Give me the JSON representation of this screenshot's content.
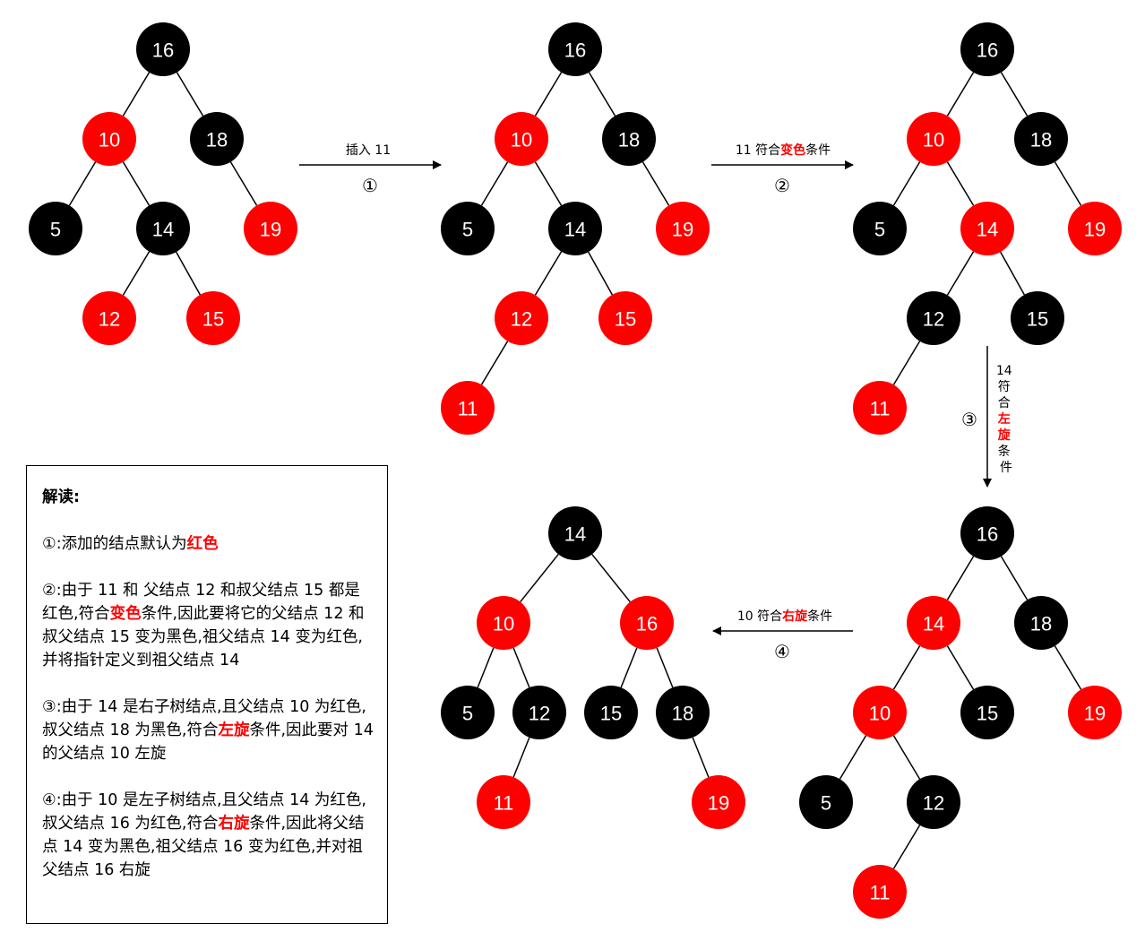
{
  "colors": {
    "red": "#ff0000",
    "black": "#000000"
  },
  "trees": [
    {
      "nodes": [
        {
          "id": "n16",
          "label": "16",
          "color": "black"
        },
        {
          "id": "n10",
          "label": "10",
          "color": "red"
        },
        {
          "id": "n18",
          "label": "18",
          "color": "black"
        },
        {
          "id": "n5",
          "label": "5",
          "color": "black"
        },
        {
          "id": "n14",
          "label": "14",
          "color": "black"
        },
        {
          "id": "n19",
          "label": "19",
          "color": "red"
        },
        {
          "id": "n12",
          "label": "12",
          "color": "red"
        },
        {
          "id": "n15",
          "label": "15",
          "color": "red"
        }
      ],
      "edges": [
        [
          "n16",
          "n10"
        ],
        [
          "n16",
          "n18"
        ],
        [
          "n10",
          "n5"
        ],
        [
          "n10",
          "n14"
        ],
        [
          "n18",
          "n19"
        ],
        [
          "n14",
          "n12"
        ],
        [
          "n14",
          "n15"
        ]
      ]
    },
    {
      "nodes": [
        {
          "id": "n16",
          "label": "16",
          "color": "black"
        },
        {
          "id": "n10",
          "label": "10",
          "color": "red"
        },
        {
          "id": "n18",
          "label": "18",
          "color": "black"
        },
        {
          "id": "n5",
          "label": "5",
          "color": "black"
        },
        {
          "id": "n14",
          "label": "14",
          "color": "black"
        },
        {
          "id": "n19",
          "label": "19",
          "color": "red"
        },
        {
          "id": "n12",
          "label": "12",
          "color": "red"
        },
        {
          "id": "n15",
          "label": "15",
          "color": "red"
        },
        {
          "id": "n11",
          "label": "11",
          "color": "red"
        }
      ],
      "edges": [
        [
          "n16",
          "n10"
        ],
        [
          "n16",
          "n18"
        ],
        [
          "n10",
          "n5"
        ],
        [
          "n10",
          "n14"
        ],
        [
          "n18",
          "n19"
        ],
        [
          "n14",
          "n12"
        ],
        [
          "n14",
          "n15"
        ],
        [
          "n12",
          "n11"
        ]
      ]
    },
    {
      "nodes": [
        {
          "id": "n16",
          "label": "16",
          "color": "black"
        },
        {
          "id": "n10",
          "label": "10",
          "color": "red"
        },
        {
          "id": "n18",
          "label": "18",
          "color": "black"
        },
        {
          "id": "n5",
          "label": "5",
          "color": "black"
        },
        {
          "id": "n14",
          "label": "14",
          "color": "red"
        },
        {
          "id": "n19",
          "label": "19",
          "color": "red"
        },
        {
          "id": "n12",
          "label": "12",
          "color": "black"
        },
        {
          "id": "n15",
          "label": "15",
          "color": "black"
        },
        {
          "id": "n11",
          "label": "11",
          "color": "red"
        }
      ],
      "edges": [
        [
          "n16",
          "n10"
        ],
        [
          "n16",
          "n18"
        ],
        [
          "n10",
          "n5"
        ],
        [
          "n10",
          "n14"
        ],
        [
          "n18",
          "n19"
        ],
        [
          "n14",
          "n12"
        ],
        [
          "n14",
          "n15"
        ],
        [
          "n12",
          "n11"
        ]
      ]
    },
    {
      "nodes": [
        {
          "id": "n16",
          "label": "16",
          "color": "black"
        },
        {
          "id": "n14",
          "label": "14",
          "color": "red"
        },
        {
          "id": "n18",
          "label": "18",
          "color": "black"
        },
        {
          "id": "n10",
          "label": "10",
          "color": "red"
        },
        {
          "id": "n15",
          "label": "15",
          "color": "black"
        },
        {
          "id": "n19",
          "label": "19",
          "color": "red"
        },
        {
          "id": "n5",
          "label": "5",
          "color": "black"
        },
        {
          "id": "n12",
          "label": "12",
          "color": "black"
        },
        {
          "id": "n11",
          "label": "11",
          "color": "red"
        }
      ],
      "edges": [
        [
          "n16",
          "n14"
        ],
        [
          "n16",
          "n18"
        ],
        [
          "n14",
          "n10"
        ],
        [
          "n14",
          "n15"
        ],
        [
          "n18",
          "n19"
        ],
        [
          "n10",
          "n5"
        ],
        [
          "n10",
          "n12"
        ],
        [
          "n12",
          "n11"
        ]
      ]
    },
    {
      "nodes": [
        {
          "id": "n14",
          "label": "14",
          "color": "black"
        },
        {
          "id": "n10",
          "label": "10",
          "color": "red"
        },
        {
          "id": "n16",
          "label": "16",
          "color": "red"
        },
        {
          "id": "n5",
          "label": "5",
          "color": "black"
        },
        {
          "id": "n12",
          "label": "12",
          "color": "black"
        },
        {
          "id": "n15",
          "label": "15",
          "color": "black"
        },
        {
          "id": "n18",
          "label": "18",
          "color": "black"
        },
        {
          "id": "n11",
          "label": "11",
          "color": "red"
        },
        {
          "id": "n19",
          "label": "19",
          "color": "red"
        }
      ],
      "edges": [
        [
          "n14",
          "n10"
        ],
        [
          "n14",
          "n16"
        ],
        [
          "n10",
          "n5"
        ],
        [
          "n10",
          "n12"
        ],
        [
          "n16",
          "n15"
        ],
        [
          "n16",
          "n18"
        ],
        [
          "n12",
          "n11"
        ],
        [
          "n18",
          "n19"
        ]
      ]
    }
  ],
  "steps": [
    {
      "num": "①",
      "label_parts": [
        "插入 11"
      ]
    },
    {
      "num": "②",
      "label_parts": [
        "11 符合",
        "变色",
        "条件"
      ]
    },
    {
      "num": "③",
      "label_parts": [
        "14",
        "符",
        "合",
        "左",
        "旋",
        "条",
        "件"
      ]
    },
    {
      "num": "④",
      "label_parts": [
        "10 符合",
        "右旋",
        "条件"
      ]
    }
  ],
  "note": {
    "title": "解读:",
    "p1": {
      "a": "①:添加的结点默认为",
      "em": "红色"
    },
    "p2": {
      "a": "②:由于 11 和 父结点 12 和叔父结点 15 都是红色,符合",
      "em": "变色",
      "b": "条件,因此要将它的父结点 12 和叔父结点 15 变为黑色,祖父结点 14 变为红色,并将指针定义到祖父结点 14"
    },
    "p3": {
      "a": "③:由于 14 是右子树结点,且父结点 10 为红色,叔父结点 18 为黑色,符合",
      "em": "左旋",
      "b": "条件,因此要对 14 的父结点 10 左旋"
    },
    "p4": {
      "a": "④:由于 10 是左子树结点,且父结点 14 为红色,叔父结点 16 为红色,符合",
      "em": "右旋",
      "b": "条件,因此将父结点 14 变为黑色,祖父结点 16 变为红色,并对祖父结点 16 右旋"
    }
  }
}
